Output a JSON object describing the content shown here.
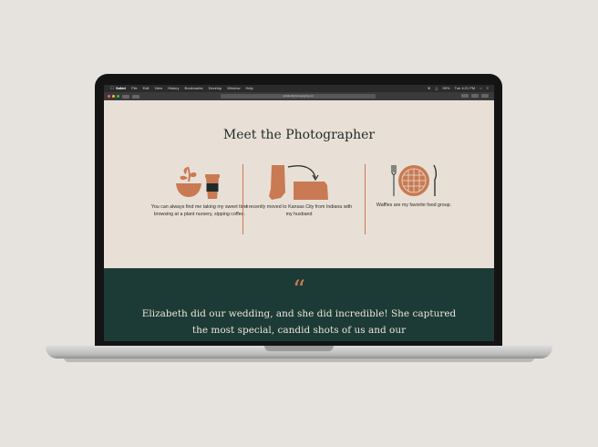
{
  "menubar": {
    "items": [
      "Safari",
      "File",
      "Edit",
      "View",
      "History",
      "Bookmarks",
      "Develop",
      "Window",
      "Help"
    ],
    "battery": "99%",
    "clock": "Tue 4:21 PM"
  },
  "toolbar": {
    "url": "elizabethphotography.net"
  },
  "page": {
    "headline": "Meet the Photographer",
    "features": [
      {
        "icon": "plant-and-coffee-icon",
        "caption": "You can always find me taking my sweet time browsing at a plant nursery, sipping coffee."
      },
      {
        "icon": "indiana-to-kansas-map-icon",
        "caption": "I recently moved to Kansas City from Indiana with my husband"
      },
      {
        "icon": "waffle-plate-icon",
        "caption": "Waffles are my favorite food group."
      }
    ],
    "quote_mark": "“",
    "testimonial": "Elizabeth did our wedding, and she did incredible! She captured the most special, candid shots of us and our"
  },
  "colors": {
    "accent": "#c97a52",
    "dark_green": "#1d3b36",
    "background": "#e8e0d6"
  }
}
